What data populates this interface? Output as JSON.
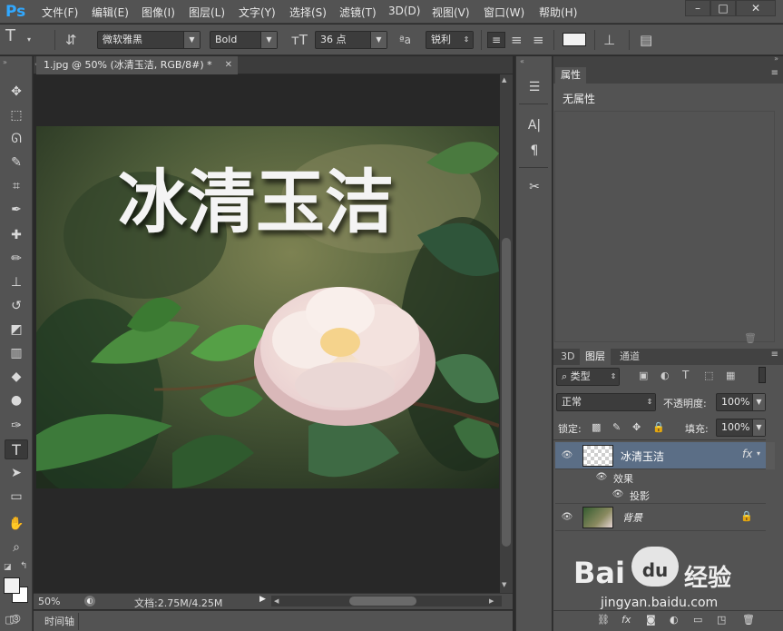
{
  "menubar": {
    "logo": "Ps",
    "items": [
      "文件(F)",
      "编辑(E)",
      "图像(I)",
      "图层(L)",
      "文字(Y)",
      "选择(S)",
      "滤镜(T)",
      "3D(D)",
      "视图(V)",
      "窗口(W)",
      "帮助(H)"
    ]
  },
  "optbar": {
    "font_family": "微软雅黑",
    "font_style": "Bold",
    "font_size": "36 点",
    "aa_label": "ªa",
    "antialias": "锐利"
  },
  "document": {
    "tab_title": "1.jpg @ 50% (冰清玉洁, RGB/8#) *",
    "canvas_text": "冰清玉洁",
    "zoom": "50%",
    "doc_info": "文档:2.75M/4.25M"
  },
  "timeline": {
    "label": "时间轴"
  },
  "properties": {
    "tab": "属性",
    "content": "无属性"
  },
  "layers_panel": {
    "tabs": [
      "3D",
      "图层",
      "通道"
    ],
    "filter_kind": "类型",
    "blend_mode": "正常",
    "opacity_label": "不透明度:",
    "opacity_value": "100%",
    "lock_label": "锁定:",
    "fill_label": "填充:",
    "fill_value": "100%",
    "layers": [
      {
        "name": "冰清玉洁",
        "fx": "fx"
      },
      {
        "effect_group": "效果"
      },
      {
        "effect": "投影"
      },
      {
        "name": "背景"
      }
    ]
  },
  "watermark": {
    "brand": "Bai",
    "paw": "du",
    "cn": "经验",
    "url": "jingyan.baidu.com"
  },
  "colors": {
    "chrome": "#535353",
    "dark": "#282828",
    "accent_ps": "#31a8ff",
    "selected_layer": "#5b6e86"
  }
}
